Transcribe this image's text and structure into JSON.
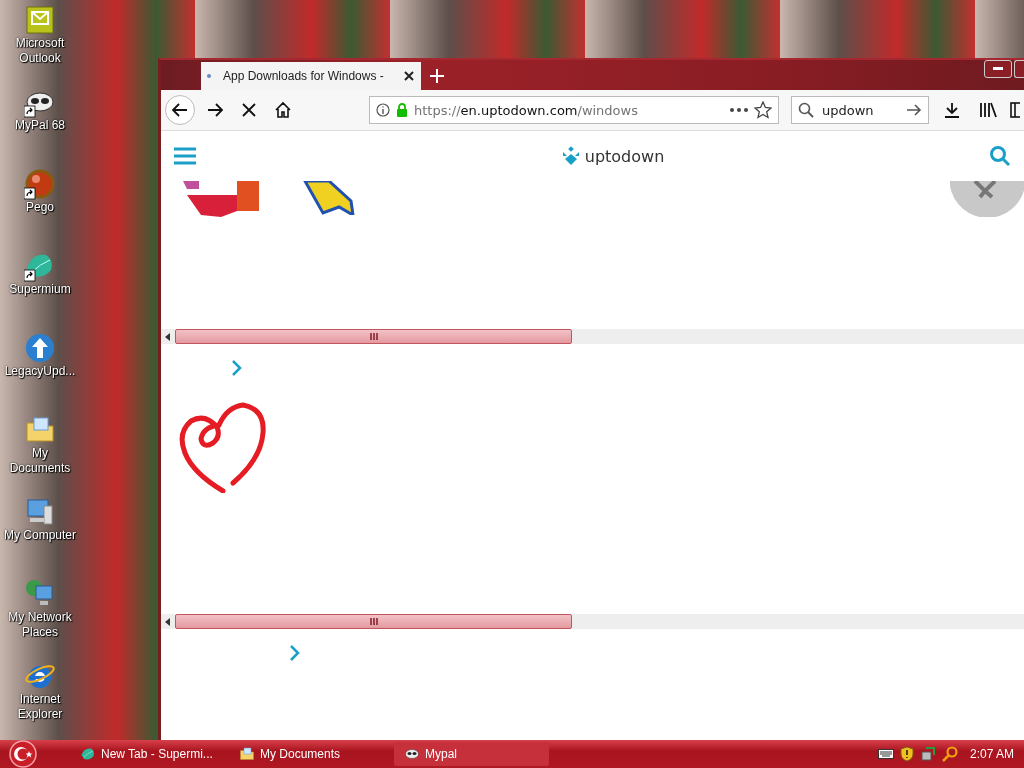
{
  "desktop": {
    "icons": [
      {
        "kind": "outlook",
        "label": "Microsoft Outlook",
        "shortcut": false
      },
      {
        "kind": "mypal",
        "label": "MyPal 68",
        "shortcut": true
      },
      {
        "kind": "pego",
        "label": "Pego",
        "shortcut": true
      },
      {
        "kind": "supermium",
        "label": "Supermium",
        "shortcut": true
      },
      {
        "kind": "legacy",
        "label": "LegacyUpd...",
        "shortcut": false
      },
      {
        "kind": "documents",
        "label": "My Documents",
        "shortcut": false
      },
      {
        "kind": "computer",
        "label": "My Computer",
        "shortcut": false
      },
      {
        "kind": "network",
        "label": "My Network Places",
        "shortcut": false
      },
      {
        "kind": "ie",
        "label": "Internet Explorer",
        "shortcut": false
      }
    ]
  },
  "browser": {
    "tabs": [
      {
        "title": "App Downloads for Windows -",
        "selected": true
      }
    ],
    "address": {
      "scheme": "https://",
      "host": "en.uptodown.com",
      "path": "/windows"
    },
    "search": {
      "value": "updown"
    },
    "site": {
      "logo": "uptodown"
    }
  },
  "taskbar": {
    "tasks": [
      {
        "kind": "supermium",
        "label": "New Tab - Supermi...",
        "selected": false
      },
      {
        "kind": "documents",
        "label": "My Documents",
        "selected": false
      },
      {
        "kind": "mypal",
        "label": "Mypal",
        "selected": true
      }
    ],
    "clock": "2:07 AM"
  }
}
